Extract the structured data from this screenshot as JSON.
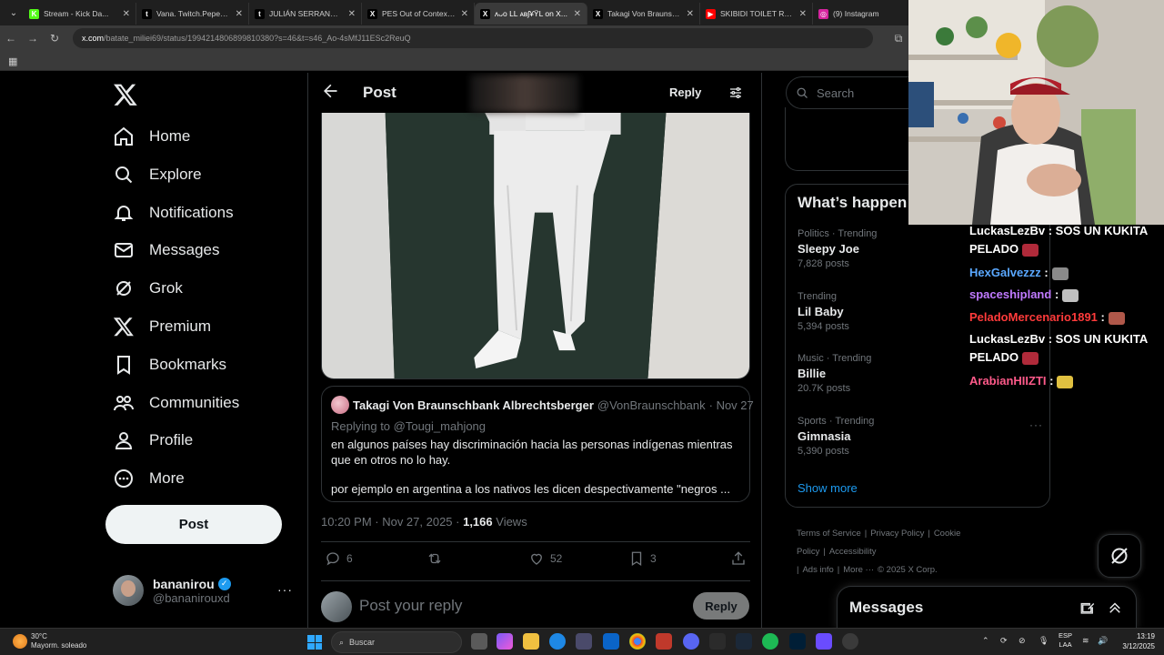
{
  "browser": {
    "tabs": [
      {
        "title": "Stream - Kick Da...",
        "favicon_color": "#53fc18",
        "fav": "K"
      },
      {
        "title": "Vana. Twitch.Pepega...",
        "favicon_color": "#010101",
        "fav": "t"
      },
      {
        "title": "JULIÁN SERRANO VS...",
        "favicon_color": "#010101",
        "fav": "t"
      },
      {
        "title": "PES Out of Context o...",
        "favicon_color": "#000000",
        "fav": "X"
      },
      {
        "title": "ᴧᴗᴏ LL ᴀʙʃ¥ΫL on X...",
        "favicon_color": "#000000",
        "fav": "X"
      },
      {
        "title": "Takagi Von Braunsche...",
        "favicon_color": "#000000",
        "fav": "X"
      },
      {
        "title": "SKIBIDI TOILET REMI...",
        "favicon_color": "#ff0000",
        "fav": "▶"
      },
      {
        "title": "(9) Instagram",
        "favicon_color": "#d6249f",
        "fav": "◎"
      }
    ],
    "url_domain": "x.com",
    "url_path": "/batate_miliei69/status/1994214806899810380?s=46&t=s46_Ao-4sMfJ11ESc2ReuQ"
  },
  "sidebar": {
    "items": [
      {
        "label": "Home",
        "icon": "home-icon"
      },
      {
        "label": "Explore",
        "icon": "search-icon"
      },
      {
        "label": "Notifications",
        "icon": "bell-icon"
      },
      {
        "label": "Messages",
        "icon": "mail-icon"
      },
      {
        "label": "Grok",
        "icon": "grok-icon"
      },
      {
        "label": "Premium",
        "icon": "x-logo-icon"
      },
      {
        "label": "Bookmarks",
        "icon": "bookmark-icon"
      },
      {
        "label": "Communities",
        "icon": "communities-icon"
      },
      {
        "label": "Profile",
        "icon": "person-icon"
      },
      {
        "label": "More",
        "icon": "more-circle-icon"
      }
    ],
    "post_label": "Post",
    "account": {
      "name": "bananirou",
      "handle": "@bananirouxd"
    }
  },
  "main": {
    "title": "Post",
    "reply_label": "Reply",
    "quote": {
      "name": "Takagi Von Braunschbank Albrechtsberger",
      "handle": "@VonBraunschbank",
      "date": "· Nov 27",
      "replying_to": "Replying to @Tougi_mahjong",
      "text1": "en algunos países hay discriminación hacia las personas indígenas mientras que en otros no lo hay.",
      "text2": "por ejemplo en argentina a los nativos les dicen despectivamente \"negros ..."
    },
    "meta": {
      "time": "10:20 PM · Nov 27, 2025 · ",
      "views": "1,166",
      "views_label": " Views"
    },
    "actions": {
      "replies": "6",
      "retweets": "",
      "likes": "52",
      "bookmarks": "3"
    },
    "reply_placeholder": "Post your reply",
    "reply_button": "Reply"
  },
  "right": {
    "search_placeholder": "Search",
    "trends_title": "What’s happen",
    "trends": [
      {
        "category": "Politics · Trending",
        "name": "Sleepy Joe",
        "count": "7,828 posts"
      },
      {
        "category": "Trending",
        "name": "Lil Baby",
        "count": "5,394 posts"
      },
      {
        "category": "Music · Trending",
        "name": "Billie",
        "count": "20.7K posts"
      },
      {
        "category": "Sports · Trending",
        "name": "Gimnasia",
        "count": "5,390 posts"
      }
    ],
    "show_more": "Show more",
    "footer": [
      "Terms of Service",
      "|",
      "Privacy Policy",
      "|",
      "Cookie Policy",
      "|",
      "Accessibility",
      "|",
      "Ads info",
      "|",
      "More ···",
      "© 2025 X Corp."
    ],
    "messages_title": "Messages"
  },
  "chat": [
    {
      "user": "LuckasLezBv",
      "color": "#ffffff",
      "msg": ": SOS UN KUKITA",
      "cont": "PELADO"
    },
    {
      "user": "HexGalvezzz",
      "color": "#5aa8ff",
      "msg": ":"
    },
    {
      "user": "spaceshipland",
      "color": "#c07aff",
      "msg": ":"
    },
    {
      "user": "PeladoMercenario1891",
      "color": "#ff3b3b",
      "msg": ":"
    },
    {
      "user": "LuckasLezBv",
      "color": "#ffffff",
      "msg": ": SOS UN KUKITA",
      "cont": "PELADO"
    },
    {
      "user": "ArabianHIIZTI",
      "color": "#ff5a8a",
      "msg": ":"
    }
  ],
  "taskbar": {
    "temp": "30°C",
    "weather": "Mayorm. soleado",
    "search": "Buscar",
    "lang1": "ESP",
    "lang2": "LAA",
    "time": "13:19",
    "date": "3/12/2025"
  }
}
